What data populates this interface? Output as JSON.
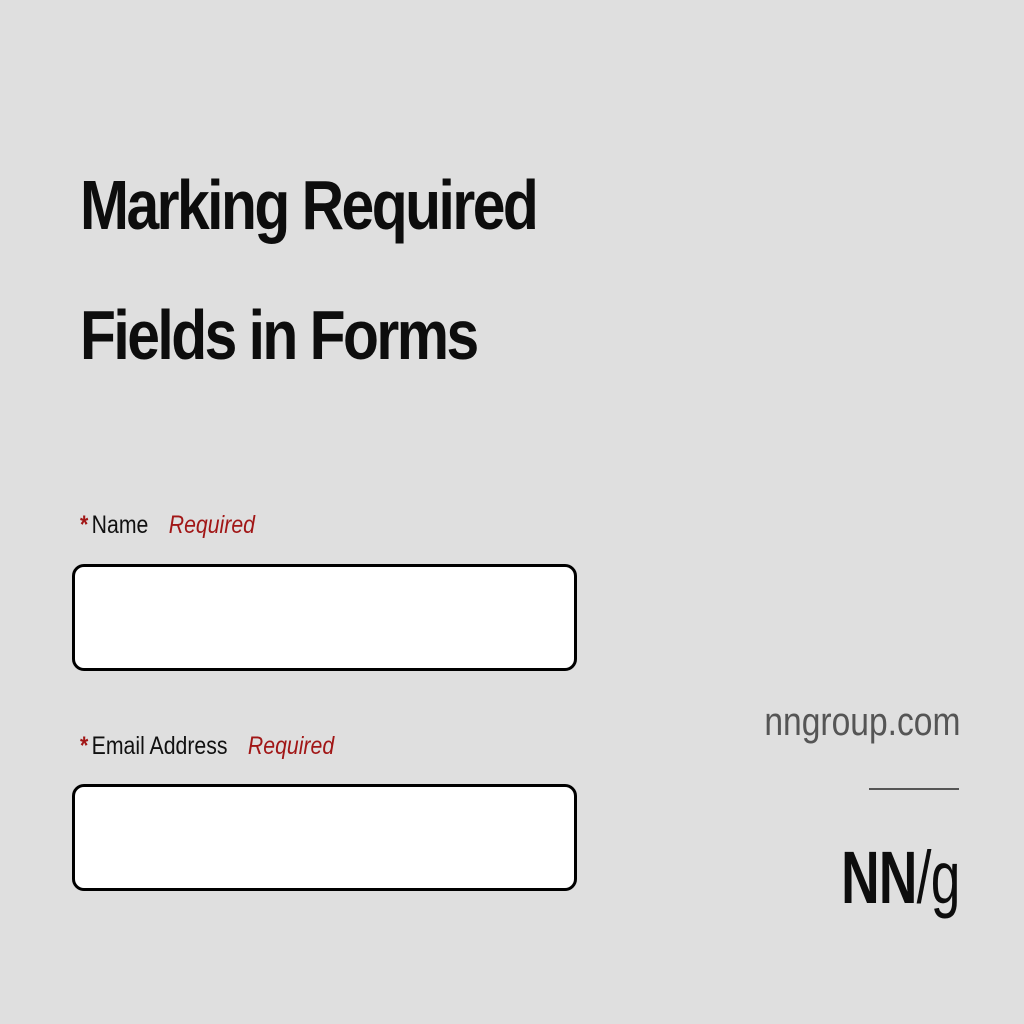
{
  "title": {
    "line1": "Marking Required",
    "line2": "Fields in Forms"
  },
  "form": {
    "fields": [
      {
        "asterisk": "*",
        "label": "Name",
        "required_text": "Required",
        "value": ""
      },
      {
        "asterisk": "*",
        "label": "Email Address",
        "required_text": "Required",
        "value": ""
      }
    ]
  },
  "branding": {
    "site": "nngroup.com",
    "logo_left": "NN",
    "logo_slash": "/",
    "logo_right": "g"
  },
  "colors": {
    "background": "#dfdfdf",
    "required_accent": "#a11616",
    "text": "#111111",
    "muted": "#555555"
  }
}
